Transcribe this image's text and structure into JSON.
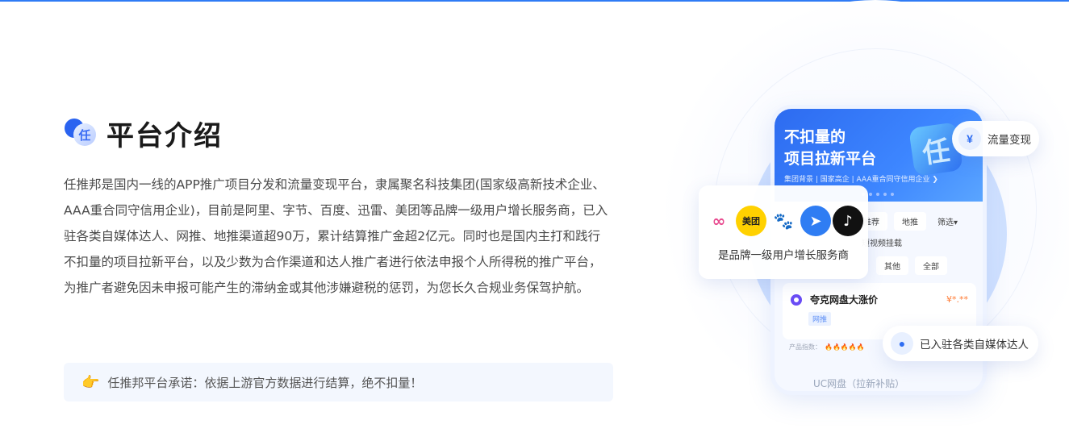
{
  "section": {
    "logo_char": "任",
    "title": "平台介绍",
    "description": "任推邦是国内一线的APP推广项目分发和流量变现平台，隶属聚名科技集团(国家级高新技术企业、AAA重合同守信用企业)，目前是阿里、字节、百度、迅雷、美团等品牌一级用户增长服务商，已入驻各类自媒体达人、网推、地推渠道超90万，累计结算推广金超2亿元。同时也是国内主打和践行不扣量的项目拉新平台，以及少数为合作渠道和达人推广者进行依法申报个人所得税的推广平台，为推广者避免因未申报可能产生的滞纳金或其他涉嫌避税的惩罚，为您长久合规业务保驾护航。",
    "promise": "任推邦平台承诺：依据上游官方数据进行结算，绝不扣量！",
    "promise_icon": "pointing-hand-icon"
  },
  "phone": {
    "banner_title": "不扣量的\n项目拉新平台",
    "banner_sub": "集团背景 | 国家高企 | AAA重合同守信用企业 ❯",
    "banner_badge": "任",
    "filters_row1": [
      "推荐",
      "地推",
      "筛选▾"
    ],
    "filters_row2": [
      "短视频挂载"
    ],
    "filters_row3": [
      "其他",
      "全部"
    ],
    "card": {
      "title": "夸克网盘大涨价",
      "price": "¥*.**",
      "tag": "网推"
    },
    "index_label": "产品指数：",
    "index_flames": "🔥🔥🔥🔥🔥",
    "bottom_text": "UC网盘（拉新补贴）"
  },
  "floats": {
    "traffic": "流量变现",
    "traffic_icon": "yen-icon",
    "media": "已入驻各类自媒体达人",
    "media_icon": "person-icon",
    "brand": "是品牌一级用户增长服务商",
    "brand_logos": [
      "cloud-logo",
      "meituan-logo",
      "baidu-logo",
      "xunlei-logo",
      "tiktok-logo"
    ],
    "meituan_text": "美团"
  },
  "colors": {
    "accent": "#2f7bf5",
    "title": "#1a1a1a",
    "promise_bg": "#f3f7fe"
  }
}
